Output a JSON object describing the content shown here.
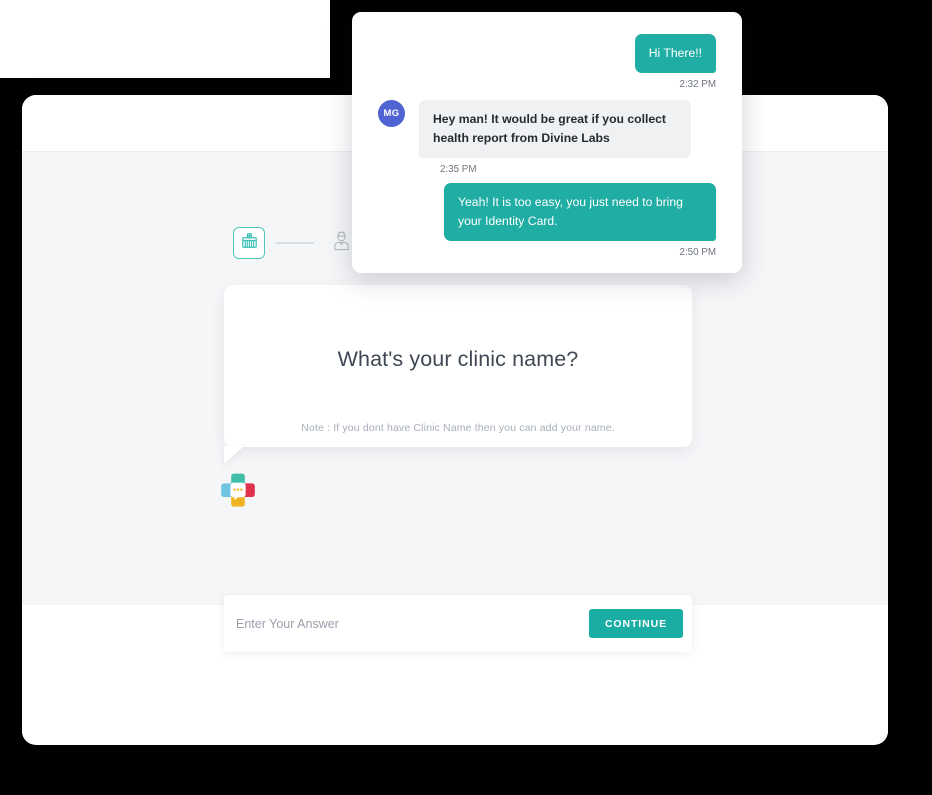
{
  "theme": {
    "accent_teal": "#1fada4",
    "step_border_teal": "#52c5bd",
    "avatar_indigo": "#4f63d2",
    "canvas_bg": "#f5f6f8",
    "page_bg": "#000000",
    "incoming_bubble_bg": "#eff1f3"
  },
  "browser": {
    "titlebar_label": "",
    "footer_label": ""
  },
  "stepper": {
    "steps": [
      {
        "icon": "clinic-building-icon",
        "state": "active"
      },
      {
        "icon": "doctor-person-icon",
        "state": "inactive"
      }
    ]
  },
  "question_card": {
    "question": "What's your clinic name?",
    "note": "Note : If you dont have Clinic Name then you can add your name."
  },
  "brand": {
    "logo_icon": "medical-cross-chat-logo",
    "logo_colors": {
      "top": "#3fbfa8",
      "left": "#6fc5e0",
      "right": "#e0324f",
      "bottom": "#f0b323",
      "center": "#ffffff"
    }
  },
  "answer_bar": {
    "placeholder": "Enter Your Answer",
    "value": "",
    "continue_label": "CONTINUE"
  },
  "chat": {
    "messages": [
      {
        "id": "msg-1",
        "direction": "outgoing",
        "text": "Hi There!!",
        "time": "2:32 PM",
        "avatar_initials": null
      },
      {
        "id": "msg-2",
        "direction": "incoming",
        "text": "Hey man! It would be great if you collect health report from Divine Labs",
        "time": "2:35 PM",
        "avatar_initials": "MG"
      },
      {
        "id": "msg-3",
        "direction": "outgoing",
        "text": "Yeah! It is too easy, you just need to bring your Identity Card.",
        "time": "2:50 PM",
        "avatar_initials": null
      }
    ]
  }
}
